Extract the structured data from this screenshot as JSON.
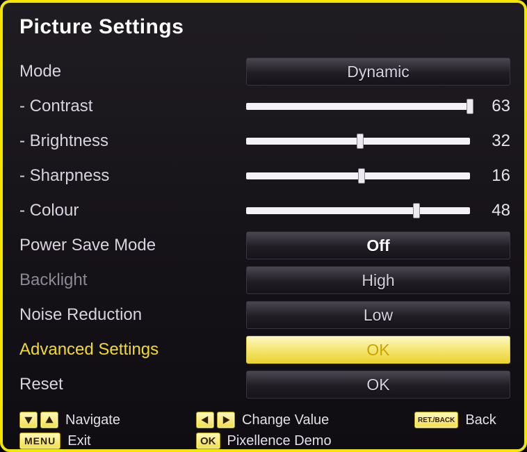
{
  "title": "Picture Settings",
  "rows": {
    "mode": {
      "label": "Mode",
      "value": "Dynamic"
    },
    "contrast": {
      "label": "- Contrast",
      "value": 63,
      "max": 63
    },
    "brightness": {
      "label": "- Brightness",
      "value": 32,
      "max": 63
    },
    "sharpness": {
      "label": "- Sharpness",
      "value": 16,
      "max": 31
    },
    "colour": {
      "label": "- Colour",
      "value": 48,
      "max": 63
    },
    "powersave": {
      "label": "Power Save Mode",
      "value": "Off"
    },
    "backlight": {
      "label": "Backlight",
      "value": "High"
    },
    "noise": {
      "label": "Noise Reduction",
      "value": "Low"
    },
    "advanced": {
      "label": "Advanced Settings",
      "value": "OK"
    },
    "reset": {
      "label": "Reset",
      "value": "OK"
    }
  },
  "footer": {
    "navigate": "Navigate",
    "change": "Change Value",
    "back": "Back",
    "exit": "Exit",
    "pixdemo": "Pixellence Demo",
    "menu_btn": "MENU",
    "ok_btn": "OK",
    "ret_btn": "RET./BACK"
  }
}
